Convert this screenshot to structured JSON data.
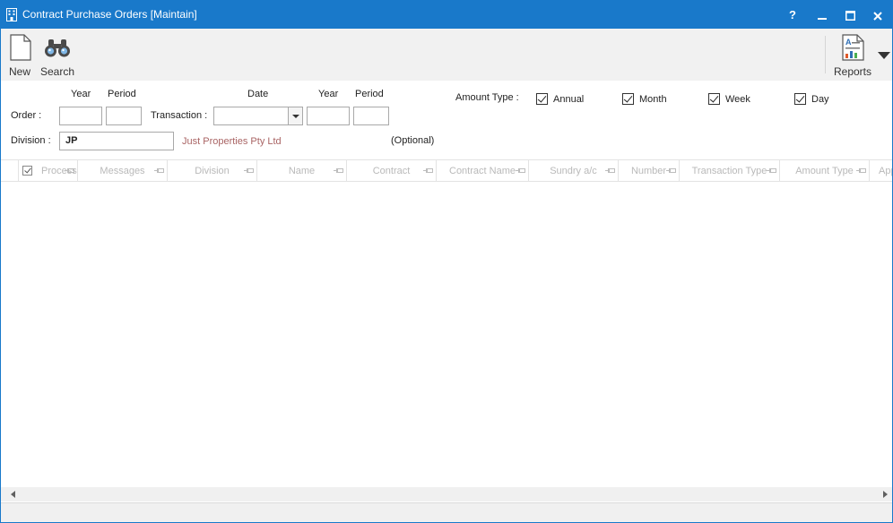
{
  "window": {
    "title": "Contract Purchase Orders [Maintain]",
    "accent_color": "#1979ca",
    "controls": {
      "help": "?",
      "minimize_icon": "minimize-icon",
      "maximize_icon": "maximize-icon",
      "close_icon": "close-icon"
    }
  },
  "ribbon": {
    "new_label": "New",
    "search_label": "Search",
    "reports_label": "Reports",
    "icons": {
      "new": "document-icon",
      "search": "binoculars-icon",
      "reports": "report-icon",
      "more": "dropdown-arrow-icon"
    }
  },
  "filters": {
    "order_label": "Order :",
    "year_label": "Year",
    "period_label": "Period",
    "transaction_label": "Transaction :",
    "date_label": "Date",
    "year2_label": "Year",
    "period2_label": "Period",
    "order_year_value": "",
    "order_period_value": "",
    "transaction_date_value": "",
    "transaction_year_value": "",
    "transaction_period_value": "",
    "division_label": "Division :",
    "division_value": "JP",
    "division_name": "Just Properties Pty Ltd",
    "optional_label": "(Optional)",
    "amount_type_label": "Amount Type :",
    "amount_types": [
      {
        "label": "Annual",
        "checked": true
      },
      {
        "label": "Month",
        "checked": true
      },
      {
        "label": "Week",
        "checked": true
      },
      {
        "label": "Day",
        "checked": true
      }
    ]
  },
  "grid": {
    "columns": [
      "Process",
      "Messages",
      "Division",
      "Name",
      "Contract",
      "Contract Name",
      "Sundry a/c",
      "Number",
      "Transaction Type",
      "Amount Type",
      "Approved"
    ],
    "rows": []
  }
}
